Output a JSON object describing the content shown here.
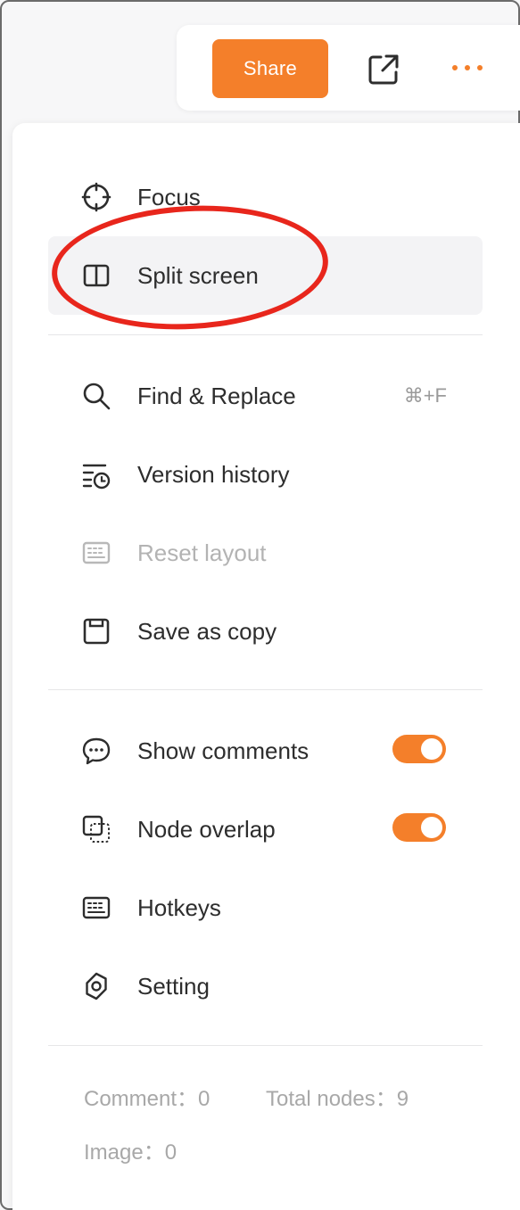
{
  "toolbar": {
    "share_label": "Share",
    "icons": [
      "open-external-icon",
      "more-icon"
    ]
  },
  "menu": {
    "focus": "Focus",
    "split_screen": "Split screen",
    "find_replace": "Find & Replace",
    "find_replace_shortcut": "⌘+F",
    "version_history": "Version history",
    "reset_layout": "Reset layout",
    "save_as_copy": "Save as copy",
    "show_comments": "Show comments",
    "node_overlap": "Node overlap",
    "hotkeys": "Hotkeys",
    "setting": "Setting"
  },
  "toggles": {
    "show_comments_on": true,
    "node_overlap_on": true
  },
  "stats": {
    "comment": "Comment：0",
    "total_nodes": "Total nodes：9",
    "image": "Image：0"
  },
  "colors": {
    "accent": "#f47f2a",
    "annotation": "#e8261c"
  }
}
